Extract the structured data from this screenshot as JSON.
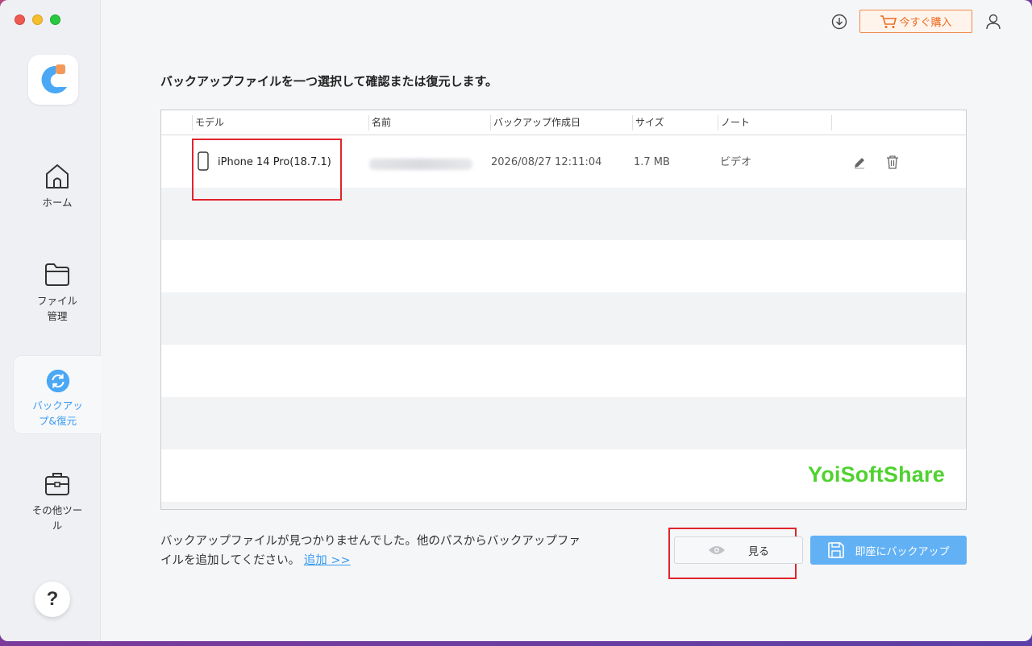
{
  "sidebar": {
    "items": [
      {
        "label_line1": "ホーム",
        "label_line2": ""
      },
      {
        "label_line1": "ファイル",
        "label_line2": "管理"
      },
      {
        "label_line1": "バックアッ",
        "label_line2": "プ&復元"
      },
      {
        "label_line1": "その他ツー",
        "label_line2": "ル"
      }
    ],
    "help": "?"
  },
  "topbar": {
    "buy_label": "今すぐ購入"
  },
  "main": {
    "heading": "バックアップファイルを一つ選択して確認または復元します。",
    "table": {
      "headers": [
        "モデル",
        "名前",
        "バックアップ作成日",
        "サイズ",
        "ノート"
      ],
      "rows": [
        {
          "model": "iPhone 14 Pro(18.7.1)",
          "name": "",
          "date": "2026/08/27 12:11:04",
          "size": "1.7 MB",
          "note": "ビデオ"
        }
      ]
    },
    "watermark": "YoiSoftShare",
    "footer_text": "バックアップファイルが見つかりませんでした。他のパスからバックアップファイルを追加してください。",
    "footer_link": "追加 >>",
    "view_button": "見る",
    "backup_button": "即座にバックアップ"
  },
  "colors": {
    "accent": "#3a9af0",
    "buy": "#ee6a1d",
    "highlight": "#e0242c",
    "watermark": "#4fd22f"
  }
}
